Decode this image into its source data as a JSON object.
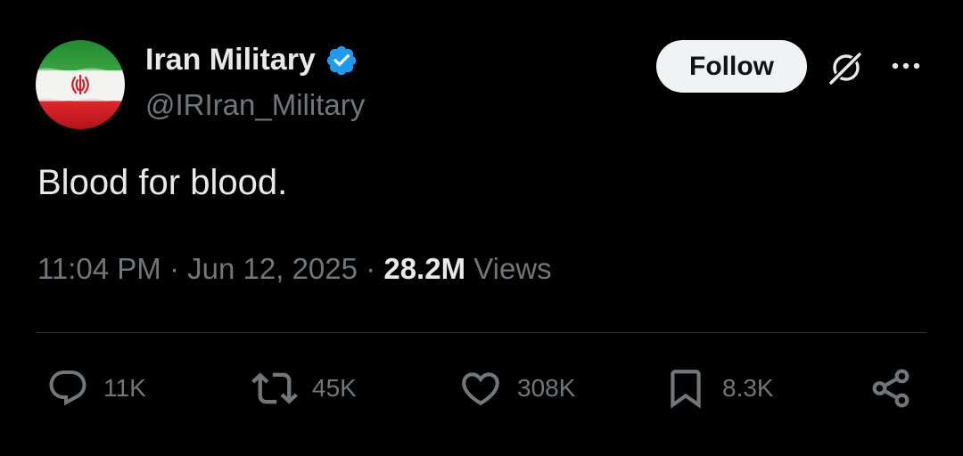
{
  "author": {
    "display_name": "Iran Military",
    "handle": "@IRIran_Military",
    "avatar_icon": "iran-flag-avatar-icon",
    "verified_icon": "verified-badge-icon",
    "verified_color": "#1d9bf0"
  },
  "header": {
    "follow_label": "Follow",
    "grok_icon": "grok-icon",
    "more_icon": "more-options-icon"
  },
  "tweet": {
    "text": "Blood for blood.",
    "time": "11:04 PM",
    "date": "Jun 12, 2025",
    "separator": "·",
    "views_count": "28.2M",
    "views_label": "Views"
  },
  "actions": {
    "replies": {
      "icon": "reply-icon",
      "count": "11K"
    },
    "reposts": {
      "icon": "repost-icon",
      "count": "45K"
    },
    "likes": {
      "icon": "heart-icon",
      "count": "308K"
    },
    "bookmarks": {
      "icon": "bookmark-icon",
      "count": "8.3K"
    },
    "share": {
      "icon": "share-icon"
    }
  },
  "colors": {
    "background": "#000000",
    "primary_text": "#e7e9ea",
    "secondary_text": "#71767b",
    "divider": "#2f3336",
    "follow_bg": "#eff3f4"
  }
}
